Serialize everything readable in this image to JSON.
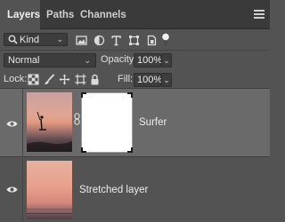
{
  "tabs": [
    {
      "label": "Layers",
      "active": true
    },
    {
      "label": "Paths",
      "active": false
    },
    {
      "label": "Channels",
      "active": false
    }
  ],
  "panel_menu_icon": "hamburger-menu-icon",
  "filter": {
    "kind_label": "Kind",
    "icons": [
      "pixel-layer-filter-icon",
      "adjustment-layer-filter-icon",
      "type-layer-filter-icon",
      "shape-layer-filter-icon",
      "smart-object-filter-icon",
      "filter-toggle-icon"
    ]
  },
  "blend_mode": {
    "value": "Normal"
  },
  "opacity": {
    "label": "Opacity:",
    "value": "100%"
  },
  "lock": {
    "label": "Lock:",
    "icons": [
      "lock-transparent-pixels-icon",
      "lock-image-pixels-icon",
      "lock-position-icon",
      "lock-artboard-icon",
      "lock-all-icon"
    ]
  },
  "fill": {
    "label": "Fill:",
    "value": "100%"
  },
  "layers": [
    {
      "name": "Surfer",
      "visible": true,
      "selected": true,
      "has_mask": true,
      "linked": true
    },
    {
      "name": "Stretched layer",
      "visible": true,
      "selected": false,
      "has_mask": false
    }
  ],
  "colors": {
    "panel_bg": "#535353",
    "tab_bar_bg": "#3a3a3a",
    "selected_layer_bg": "#6a6a6a",
    "field_bg": "#3d3d3d"
  }
}
